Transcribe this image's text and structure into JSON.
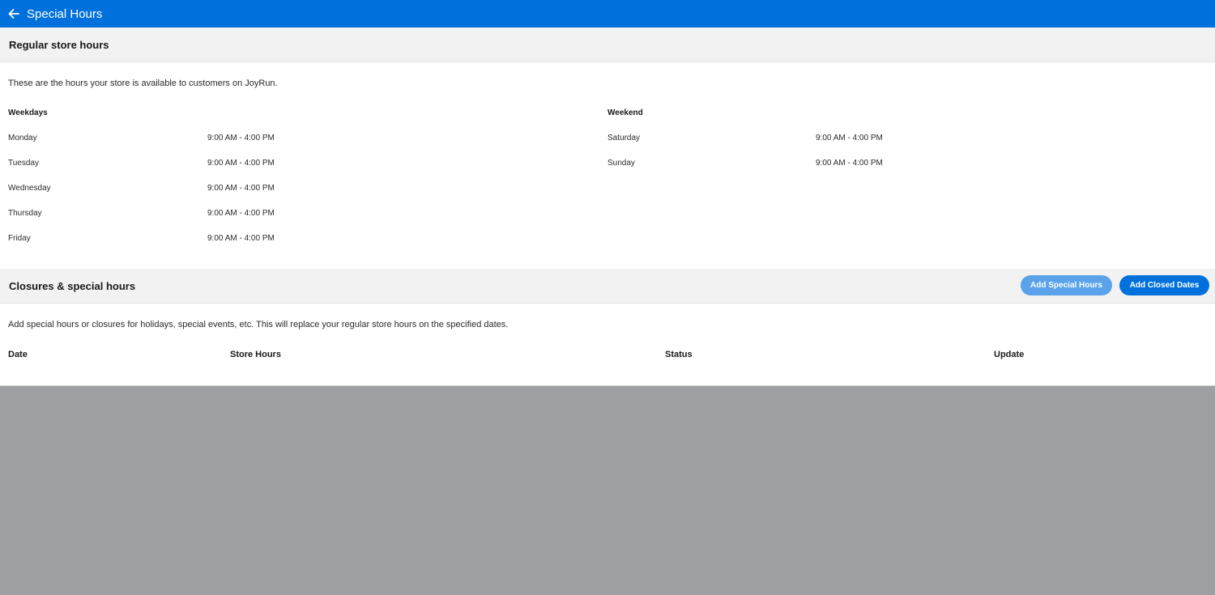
{
  "header": {
    "title": "Special Hours",
    "back_icon": "arrow-left-icon",
    "color": "#0071dc"
  },
  "regular": {
    "title": "Regular store hours",
    "description": "These are the hours your store is available to customers on JoyRun.",
    "weekdays_label": "Weekdays",
    "weekend_label": "Weekend",
    "weekdays": [
      {
        "day": "Monday",
        "hours": "9:00 AM - 4:00 PM"
      },
      {
        "day": "Tuesday",
        "hours": "9:00 AM - 4:00 PM"
      },
      {
        "day": "Wednesday",
        "hours": "9:00 AM - 4:00 PM"
      },
      {
        "day": "Thursday",
        "hours": "9:00 AM - 4:00 PM"
      },
      {
        "day": "Friday",
        "hours": "9:00 AM - 4:00 PM"
      }
    ],
    "weekend": [
      {
        "day": "Saturday",
        "hours": "9:00 AM - 4:00 PM"
      },
      {
        "day": "Sunday",
        "hours": "9:00 AM - 4:00 PM"
      }
    ]
  },
  "closures": {
    "title": "Closures & special hours",
    "add_special_label": "Add Special Hours",
    "add_closed_label": "Add Closed Dates",
    "description": "Add special hours or closures for holidays, special events, etc. This will replace your regular store hours on the specified dates.",
    "columns": [
      "Date",
      "Store Hours",
      "Status",
      "Update"
    ]
  }
}
